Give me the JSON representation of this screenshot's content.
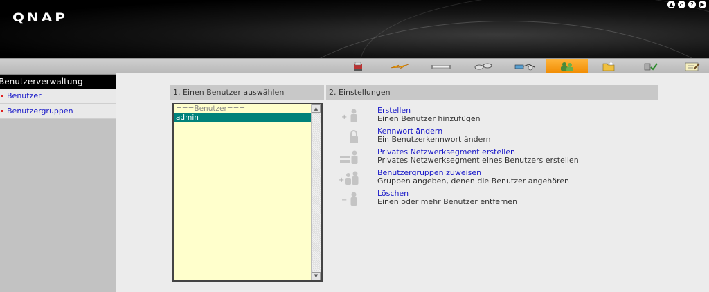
{
  "brand": {
    "logo": "QNAP"
  },
  "top_icons": [
    "up-icon",
    "home-icon",
    "help-icon",
    "logout-icon"
  ],
  "toolbar": {
    "buttons": [
      {
        "icon": "overview-icon",
        "active": false
      },
      {
        "icon": "system-settings-icon",
        "active": false
      },
      {
        "icon": "disk-management-icon",
        "active": false
      },
      {
        "icon": "network-icon",
        "active": false
      },
      {
        "icon": "network-services-icon",
        "active": false
      },
      {
        "icon": "user-management-icon",
        "active": true
      },
      {
        "icon": "shared-folders-icon",
        "active": false
      },
      {
        "icon": "system-tools-icon",
        "active": false
      },
      {
        "icon": "system-logs-icon",
        "active": false
      }
    ],
    "accent": "#f59a0b"
  },
  "sidebar": {
    "title": "Benutzerverwaltung",
    "items": [
      {
        "label": "Benutzer"
      },
      {
        "label": "Benutzergruppen"
      }
    ]
  },
  "main": {
    "step1": {
      "heading": "1. Einen Benutzer auswählen",
      "list_header": "===Benutzer===",
      "users": [
        "admin"
      ],
      "selected": "admin"
    },
    "step2": {
      "heading": "2. Einstellungen",
      "actions": [
        {
          "title": "Erstellen",
          "desc": "Einen Benutzer hinzufügen",
          "icon": "add-user-icon"
        },
        {
          "title": "Kennwort ändern",
          "desc": "Ein Benutzerkennwort ändern",
          "icon": "lock-icon"
        },
        {
          "title": "Privates Netzwerksegment erstellen",
          "desc": "Privates Netzwerksegment eines Benutzers erstellen",
          "icon": "private-network-icon"
        },
        {
          "title": "Benutzergruppen zuweisen",
          "desc": "Gruppen angeben, denen die Benutzer angehören",
          "icon": "assign-group-icon"
        },
        {
          "title": "Löschen",
          "desc": "Einen oder mehr Benutzer entfernen",
          "icon": "remove-user-icon"
        }
      ]
    }
  }
}
